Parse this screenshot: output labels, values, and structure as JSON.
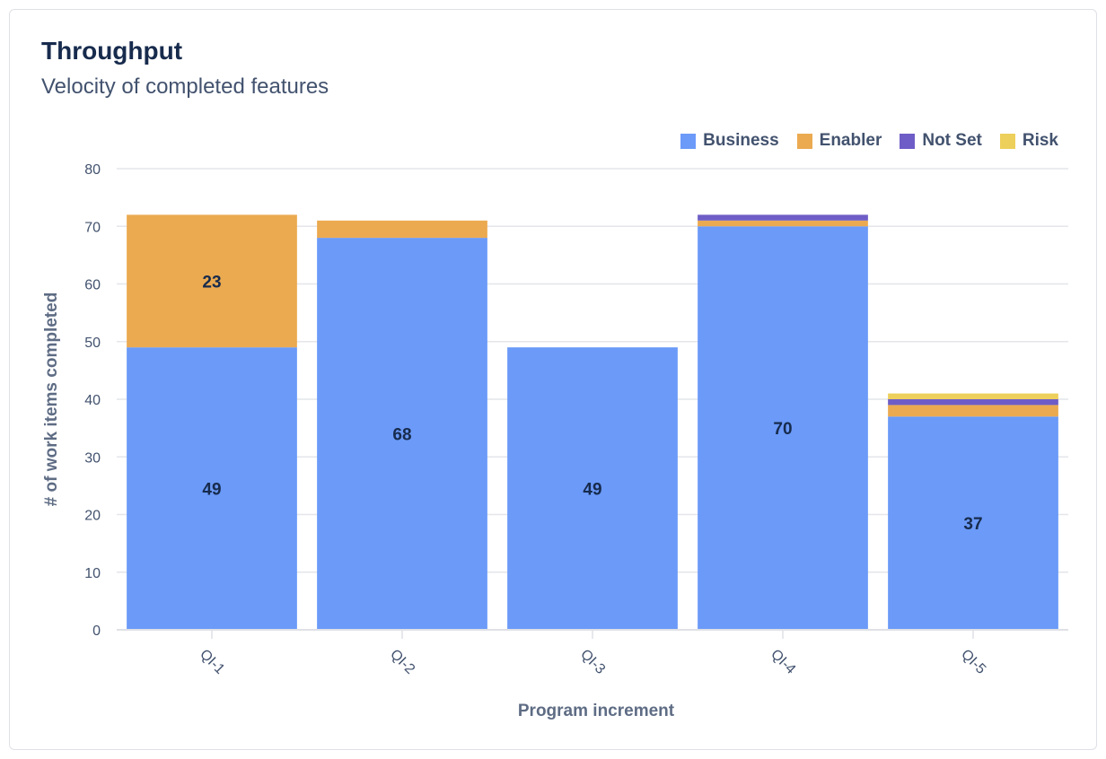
{
  "card": {
    "title": "Throughput",
    "subtitle": "Velocity of completed features"
  },
  "chart_data": {
    "type": "bar",
    "stacked": true,
    "title": "Throughput",
    "subtitle": "Velocity of completed features",
    "xlabel": "Program increment",
    "ylabel": "# of work items completed",
    "categories": [
      "QI-1",
      "QI-2",
      "QI-3",
      "QI-4",
      "QI-5"
    ],
    "ylim": [
      0,
      80
    ],
    "yticks": [
      0,
      10,
      20,
      30,
      40,
      50,
      60,
      70,
      80
    ],
    "grid": true,
    "legend_position": "top-right",
    "series": [
      {
        "name": "Business",
        "color": "#6b9af8",
        "values": [
          49,
          68,
          49,
          70,
          37
        ],
        "labels": [
          "49",
          "68",
          "49",
          "70",
          "37"
        ]
      },
      {
        "name": "Enabler",
        "color": "#ebaa50",
        "values": [
          23,
          3,
          0,
          1,
          2
        ],
        "labels": [
          "23",
          "",
          "",
          "",
          ""
        ]
      },
      {
        "name": "Not Set",
        "color": "#6e5dc6",
        "values": [
          0,
          0,
          0,
          1,
          1
        ],
        "labels": [
          "",
          "",
          "",
          "",
          ""
        ]
      },
      {
        "name": "Risk",
        "color": "#edcf5b",
        "values": [
          0,
          0,
          0,
          0,
          1
        ],
        "labels": [
          "",
          "",
          "",
          "",
          ""
        ]
      }
    ]
  }
}
